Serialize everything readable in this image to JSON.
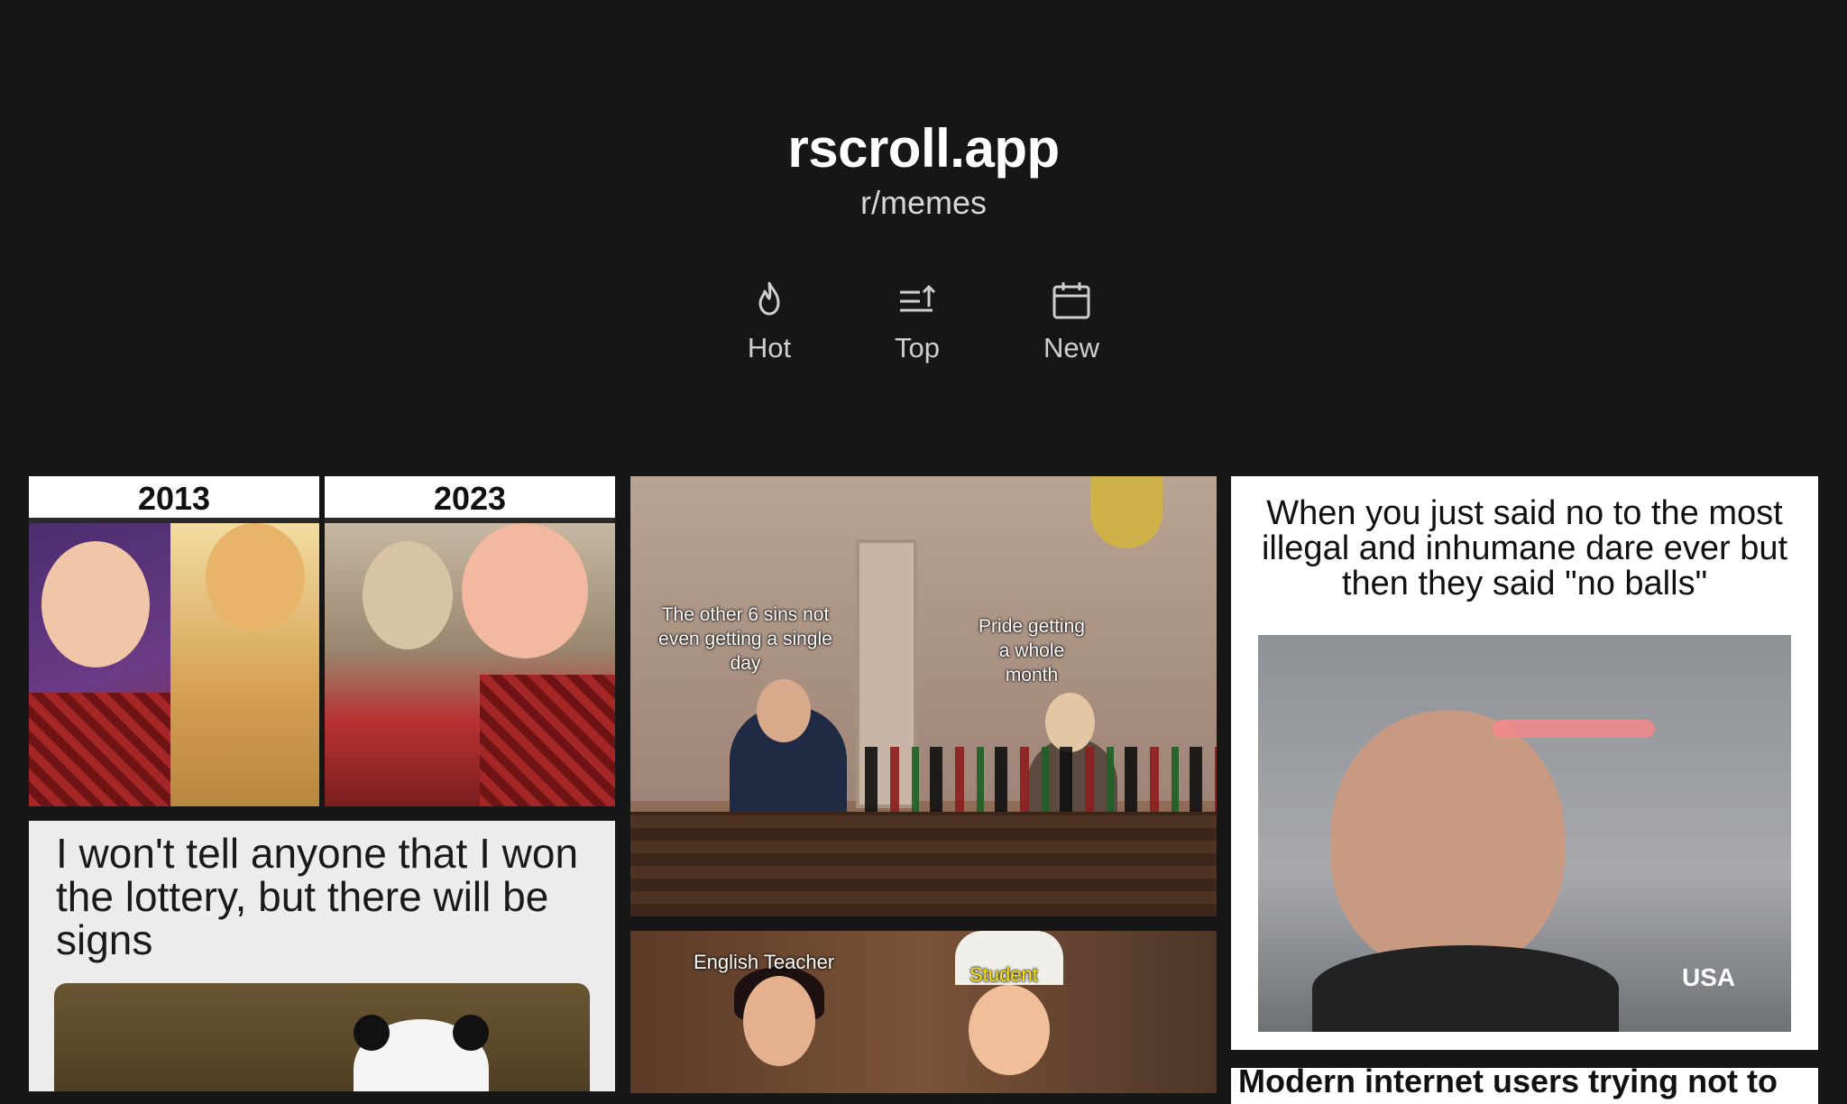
{
  "header": {
    "site_title": "rscroll.app",
    "subreddit": "r/memes"
  },
  "sort_tabs": [
    {
      "label": "Hot",
      "icon": "flame-icon"
    },
    {
      "label": "Top",
      "icon": "sort-arrow-icon"
    },
    {
      "label": "New",
      "icon": "calendar-icon"
    }
  ],
  "posts": [
    {
      "captions": [
        "2013",
        "2023"
      ]
    },
    {
      "captions": [
        "The other 6 sins not even getting a single day",
        "Pride getting a whole month"
      ]
    },
    {
      "captions": [
        "When you just said no to the most illegal and inhumane dare ever but then they said \"no balls\""
      ],
      "watermark": "USA"
    },
    {
      "captions": [
        "I won't tell anyone that I won the lottery, but there will be signs"
      ]
    },
    {
      "captions": [
        "English Teacher",
        "Student"
      ]
    },
    {
      "captions": [
        "Modern internet users trying not to"
      ]
    }
  ]
}
